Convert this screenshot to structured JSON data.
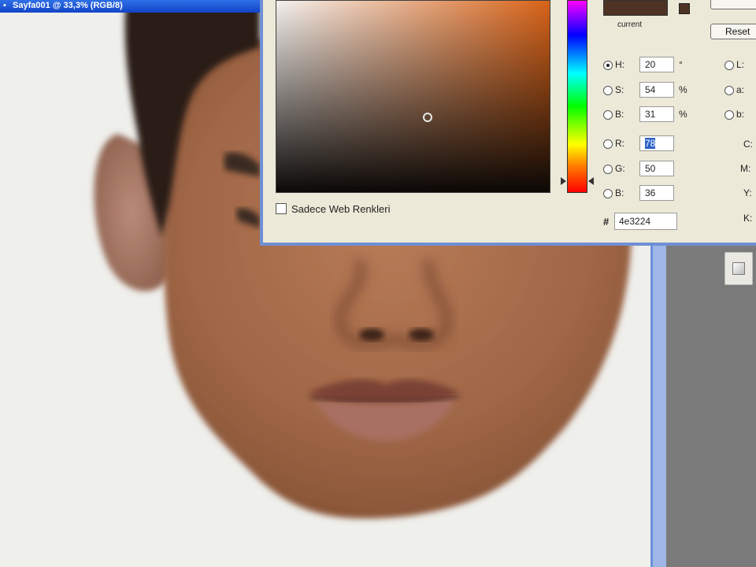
{
  "document": {
    "title": "Sayfa001 @ 33,3% (RGB/8)"
  },
  "picker": {
    "buttons": {
      "ok": "",
      "reset": "Reset"
    },
    "current_label": "current",
    "swatch_color": "#4e3224",
    "hsb": [
      {
        "label": "H:",
        "value": "20",
        "unit": "°",
        "selected": true
      },
      {
        "label": "S:",
        "value": "54",
        "unit": "%",
        "selected": false
      },
      {
        "label": "B:",
        "value": "31",
        "unit": "%",
        "selected": false
      }
    ],
    "rgb": [
      {
        "label": "R:",
        "value": "78",
        "selected_text": true
      },
      {
        "label": "G:",
        "value": "50"
      },
      {
        "label": "B:",
        "value": "36"
      }
    ],
    "lab": [
      {
        "label": "L:"
      },
      {
        "label": "a:"
      },
      {
        "label": "b:"
      }
    ],
    "cmyk_labels": [
      "C:",
      "M:",
      "Y:",
      "K:"
    ],
    "hex_label": "#",
    "hex_value": "4e3224",
    "web_only_label": "Sadece Web Renkleri",
    "web_only_checked": false
  },
  "colors": {
    "skin": "#a56d4c",
    "hair": "#2a1d16",
    "accent_blue": "#2f6fe6"
  }
}
